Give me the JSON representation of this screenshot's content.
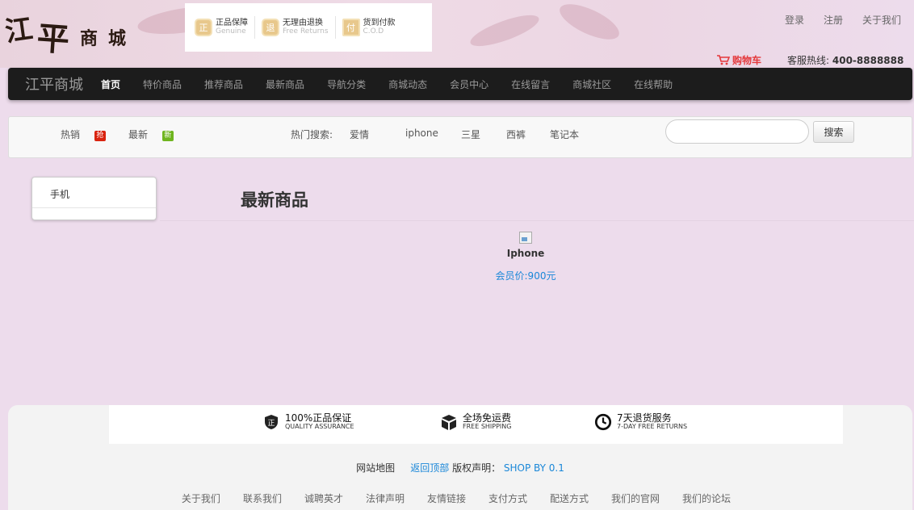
{
  "header": {
    "badges": [
      {
        "title": "正品保障",
        "subtitle": "Genuine",
        "icon": "shield-genuine-icon",
        "glyph": "正"
      },
      {
        "title": "无理由退换",
        "subtitle": "Free Returns",
        "icon": "shield-return-icon",
        "glyph": "退"
      },
      {
        "title": "货到付款",
        "subtitle": "C.O.D",
        "icon": "cod-icon",
        "glyph": "付"
      }
    ],
    "top_links": [
      "登录",
      "注册",
      "关于我们"
    ],
    "cart_label": "购物车",
    "hotline_label": "客服热线:",
    "hotline_number": "400-8888888"
  },
  "nav": {
    "brand": "江平商城",
    "items": [
      "首页",
      "特价商品",
      "推荐商品",
      "最新商品",
      "导航分类",
      "商城动态",
      "会员中心",
      "在线留言",
      "商城社区",
      "在线帮助"
    ],
    "active_index": 0
  },
  "search": {
    "hot_label": "热销",
    "hot_tag": "抢",
    "new_label": "最新",
    "new_tag": "新",
    "hot_search_label": "热门搜索:",
    "keywords": [
      "爱情",
      "iphone",
      "三星",
      "西裤",
      "笔记本"
    ],
    "input_value": "",
    "button_label": "搜索"
  },
  "category": {
    "items": [
      "手机"
    ]
  },
  "section": {
    "title": "最新商品"
  },
  "products": [
    {
      "name": "Iphone",
      "price": "会员价:900元"
    }
  ],
  "footer": {
    "services": [
      {
        "title": "100%正品保证",
        "subtitle": "QUALITY ASSURANCE",
        "icon": "genuine-badge-icon"
      },
      {
        "title": "全场免运费",
        "subtitle": "FREE SHIPPING",
        "icon": "package-icon"
      },
      {
        "title": "7天退货服务",
        "subtitle": "7-DAY FREE RETURNS",
        "icon": "clock-icon"
      }
    ],
    "sitemap": "网站地图",
    "back_to_top": "返回顶部",
    "copyright_label": "版权声明：",
    "copyright_value": "SHOP BY 0.1",
    "links": [
      "关于我们",
      "联系我们",
      "诚聘英才",
      "法律声明",
      "友情链接",
      "支付方式",
      "配送方式",
      "我们的官网",
      "我们的论坛"
    ]
  },
  "colors": {
    "page_bg": "#eddcec",
    "nav_bg": "#1c1c1c",
    "cart_red": "#e4393c",
    "link_blue": "#1a87d8",
    "hot_tag": "#d9230f",
    "new_tag": "#6fb51f"
  }
}
